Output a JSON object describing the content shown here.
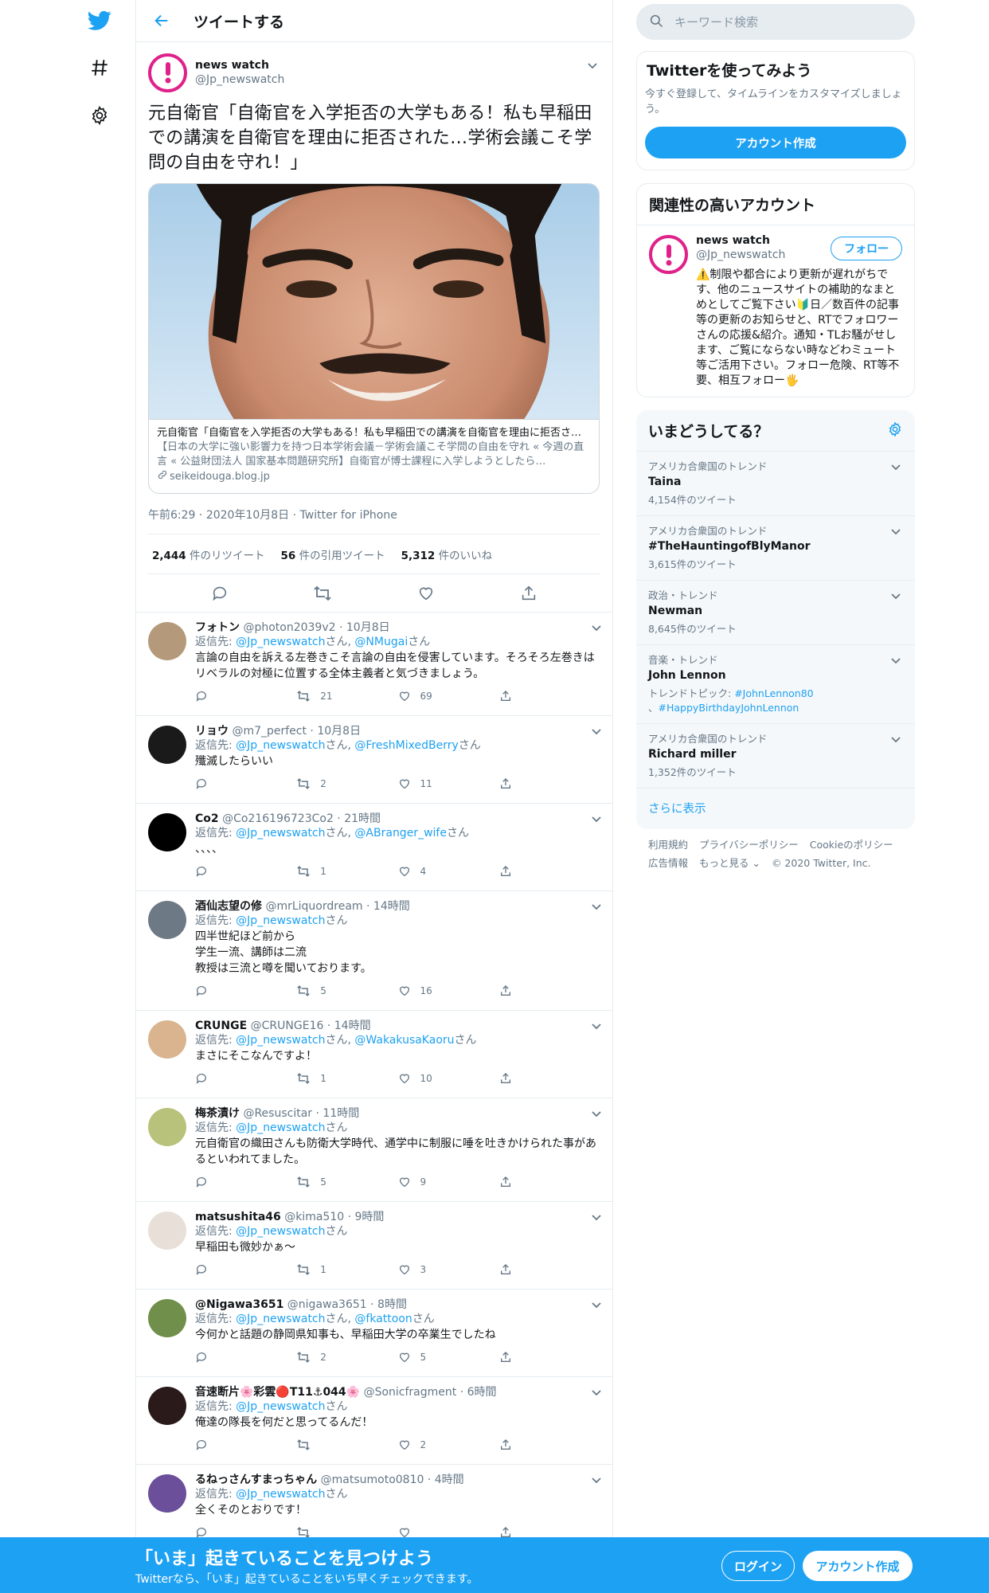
{
  "header": {
    "title": "ツイートする"
  },
  "focal": {
    "name": "news watch",
    "handle": "@Jp_newswatch",
    "text": "元自衛官「自衛官を入学拒否の大学もある！私も早稲田での講演を自衛官を理由に拒否された…学術会議こそ学問の自由を守れ！」",
    "card": {
      "title": "元自衛官「自衛官を入学拒否の大学もある！私も早稲田での講演を自衛官を理由に拒否された…学術会議こそ学問の自由を守れ！」",
      "desc": "【日本の大学に強い影響力を持つ日本学術会議－学術会議こそ学問の自由を守れ « 今週の直言 « 公益財団法人 国家基本問題研究所】自衛官が博士課程に入学しようとしたら…",
      "domain": "seikeidouga.blog.jp"
    },
    "time": "午前6:29",
    "date": "2020年10月8日",
    "client": "Twitter for iPhone",
    "retweets": "2,444",
    "retweets_label": "件のリツイート",
    "quotes": "56",
    "quotes_label": "件の引用ツイート",
    "likes": "5,312",
    "likes_label": "件のいいね"
  },
  "replies": [
    {
      "name": "フォトン",
      "handle": "@photon2039v2",
      "time": "10月8日",
      "reply_label": "返信先:",
      "to": [
        "@Jp_newswatch",
        "@NMugai"
      ],
      "suffix": "さん",
      "text": "言論の自由を訴える左巻きこそ言論の自由を侵害しています。そろそろ左巻きはリベラルの対極に位置する全体主義者と気づきましょう。",
      "retweets": "21",
      "likes": "69"
    },
    {
      "name": "リョウ",
      "handle": "@m7_perfect",
      "time": "10月8日",
      "reply_label": "返信先:",
      "to": [
        "@Jp_newswatch",
        "@FreshMixedBerry"
      ],
      "suffix": "さん",
      "text": "殲滅したらいい",
      "retweets": "2",
      "likes": "11"
    },
    {
      "name": "Co2",
      "handle": "@Co216196723Co2",
      "time": "21時間",
      "reply_label": "返信先:",
      "to": [
        "@Jp_newswatch",
        "@ABranger_wife"
      ],
      "suffix": "さん",
      "text": "、、、、",
      "retweets": "1",
      "likes": "4"
    },
    {
      "name": "酒仙志望の修",
      "handle": "@mrLiquordream",
      "time": "14時間",
      "reply_label": "返信先:",
      "to": [
        "@Jp_newswatch"
      ],
      "suffix": "さん",
      "text": "四半世紀ほど前から\n学生一流、講師は二流\n教授は三流と噂を聞いております。",
      "retweets": "5",
      "likes": "16"
    },
    {
      "name": "CRUNGE",
      "handle": "@CRUNGE16",
      "time": "14時間",
      "reply_label": "返信先:",
      "to": [
        "@Jp_newswatch",
        "@WakakusaKaoru"
      ],
      "suffix": "さん",
      "text": "まさにそこなんですよ！",
      "retweets": "1",
      "likes": "10"
    },
    {
      "name": "梅茶漬け",
      "handle": "@Resuscitar",
      "time": "11時間",
      "reply_label": "返信先:",
      "to": [
        "@Jp_newswatch"
      ],
      "suffix": "さん",
      "text": "元自衛官の織田さんも防衛大学時代、通学中に制服に唾を吐きかけられた事があるといわれてました。",
      "retweets": "5",
      "likes": "9"
    },
    {
      "name": "matsushita46",
      "handle": "@kima510",
      "time": "9時間",
      "reply_label": "返信先:",
      "to": [
        "@Jp_newswatch"
      ],
      "suffix": "さん",
      "text": "早稲田も微妙かぁ〜",
      "retweets": "1",
      "likes": "3"
    },
    {
      "name": "@Nigawa3651",
      "handle": "@nigawa3651",
      "time": "8時間",
      "reply_label": "返信先:",
      "to": [
        "@Jp_newswatch",
        "@fkattoon"
      ],
      "suffix": "さん",
      "text": "今何かと話題の静岡県知事も、早稲田大学の卒業生でしたね",
      "retweets": "2",
      "likes": "5"
    },
    {
      "name": "音速断片🌸彩雲🔴T11⚓044🌸",
      "handle": "@Sonicfragment",
      "time": "6時間",
      "reply_label": "返信先:",
      "to": [
        "@Jp_newswatch"
      ],
      "suffix": "さん",
      "text": "俺達の隊長を何だと思ってるんだ！",
      "retweets": "",
      "likes": "2"
    },
    {
      "name": "るねっさんすまっちゃん",
      "handle": "@matsumoto0810",
      "time": "4時間",
      "reply_label": "返信先:",
      "to": [
        "@Jp_newswatch"
      ],
      "suffix": "さん",
      "text": "全くそのとおりです！",
      "retweets": "",
      "likes": ""
    }
  ],
  "sidebar": {
    "search_placeholder": "キーワード検索",
    "signup": {
      "title": "Twitterを使ってみよう",
      "desc": "今すぐ登録して、タイムラインをカスタマイズしましょう。",
      "button": "アカウント作成"
    },
    "related": {
      "title": "関連性の高いアカウント",
      "name": "news watch",
      "handle": "@Jp_newswatch",
      "follow": "フォロー",
      "bio": "⚠️制限や都合により更新が遅れがちです、他のニュースサイトの補助的なまとめとしてご覧下さい🔰日／数百件の記事等の更新のお知らせと、RTでフォロワーさんの応援&紹介。通知・TLお騒がせします、ご覧にならない時などわミュート等ご活用下さい。フォロー危険、RT等不要、相互フォロー🖐"
    },
    "trends": {
      "title": "いまどうしてる？",
      "items": [
        {
          "context": "アメリカ合衆国のトレンド",
          "name": "Taina",
          "count": "4,154件のツイート"
        },
        {
          "context": "アメリカ合衆国のトレンド",
          "name": "#TheHauntingofBlyManor",
          "count": "3,615件のツイート"
        },
        {
          "context": "政治・トレンド",
          "name": "Newman",
          "count": "8,645件のツイート"
        },
        {
          "context": "音楽・トレンド",
          "name": "John Lennon",
          "count": "",
          "topic_label": "トレンドトピック:",
          "topic1": "#JohnLennon80",
          "topic2": "#HappyBirthdayJohnLennon"
        },
        {
          "context": "アメリカ合衆国のトレンド",
          "name": "Richard miller",
          "count": "1,352件のツイート"
        }
      ],
      "show_more": "さらに表示"
    },
    "footer": [
      "利用規約",
      "プライバシーポリシー",
      "Cookieのポリシー",
      "広告情報",
      "もっと見る ⌄",
      "© 2020 Twitter, Inc."
    ]
  },
  "bottom_bar": {
    "title": "「いま」起きていることを見つけよう",
    "subtitle": "Twitterなら、「いま」起きていることをいち早くチェックできます。",
    "login": "ログイン",
    "signup": "アカウント作成"
  },
  "colors": {
    "accent": "#1da1f2",
    "avatar_ring": "#e0218a",
    "bottom_bar": "#1da1f2"
  }
}
